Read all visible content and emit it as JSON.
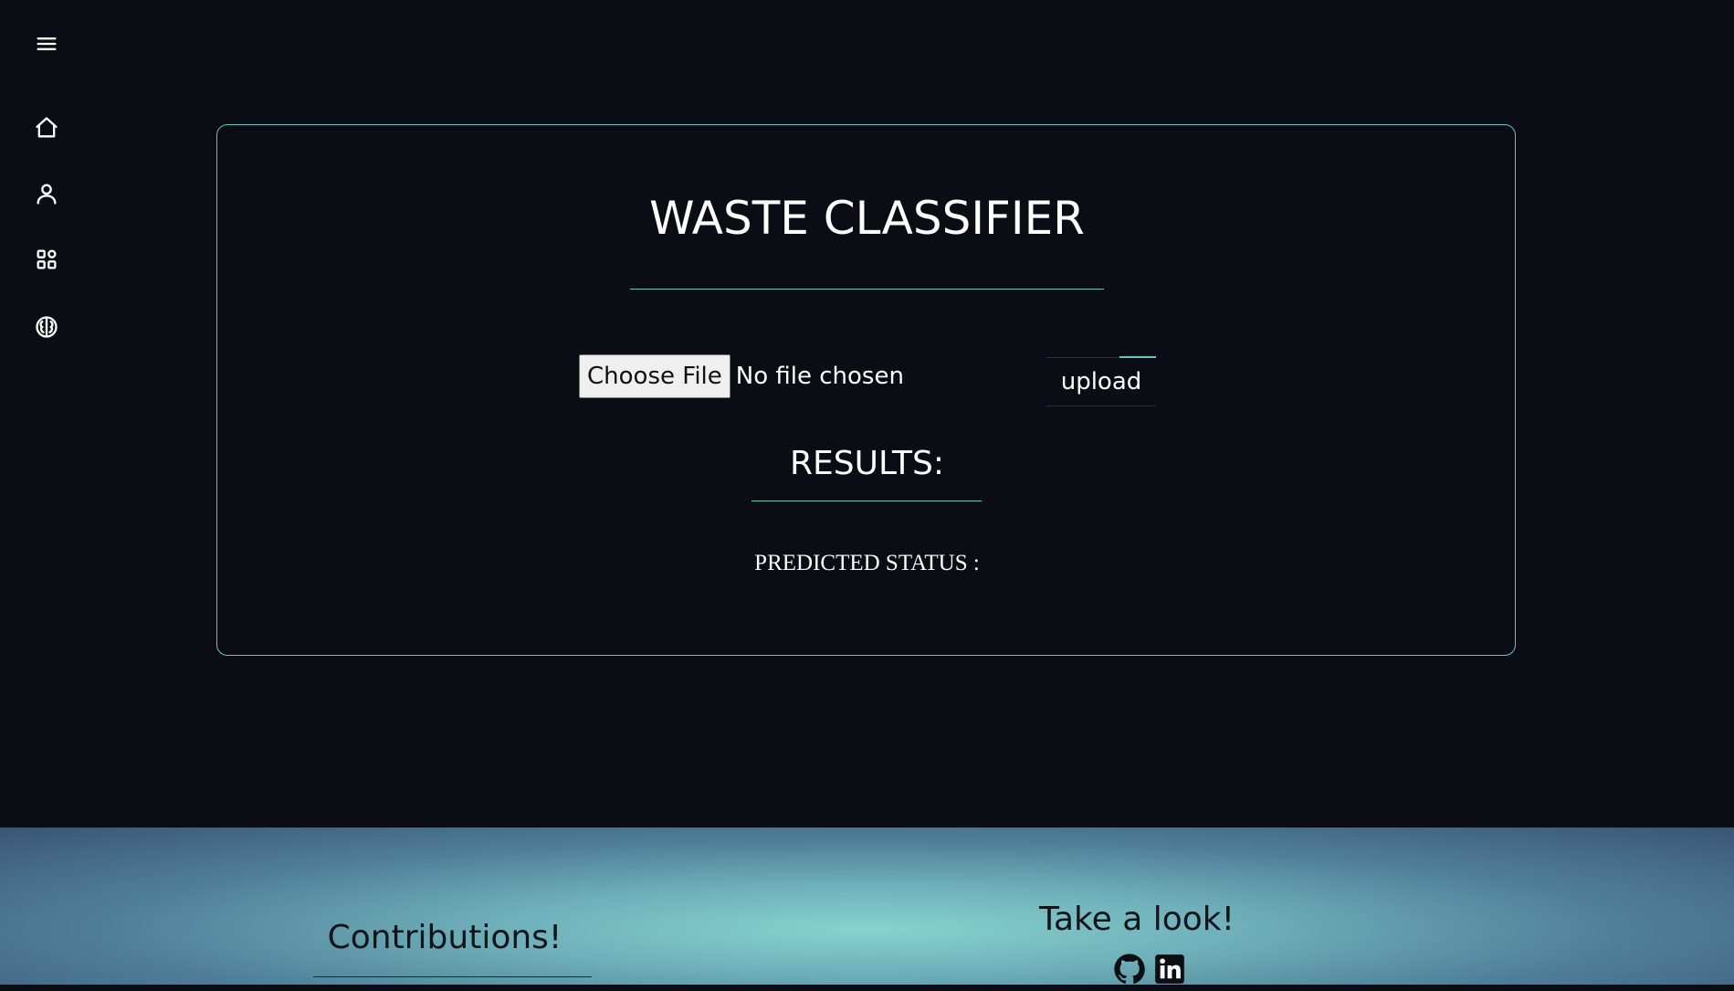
{
  "sidebar": {
    "items": [
      {
        "icon": "hamburger-menu-icon"
      },
      {
        "icon": "home-icon"
      },
      {
        "icon": "user-icon"
      },
      {
        "icon": "apps-grid-icon"
      },
      {
        "icon": "brain-icon"
      }
    ]
  },
  "main": {
    "title": "WASTE CLASSIFIER",
    "file_input": {
      "button_label": "Choose File",
      "status": "No file chosen"
    },
    "upload_label": "upload",
    "results_heading": "RESULTS:",
    "predicted_label": "PREDICTED STATUS :"
  },
  "footer": {
    "contributions": "Contributions!",
    "take_a_look": "Take a look!",
    "links": [
      {
        "icon": "github-icon"
      },
      {
        "icon": "linkedin-icon"
      }
    ]
  },
  "colors": {
    "background": "#0a0d14",
    "accent": "#5fc8c0",
    "footer_center": "#86d3cf",
    "footer_edge": "#3a5574"
  }
}
